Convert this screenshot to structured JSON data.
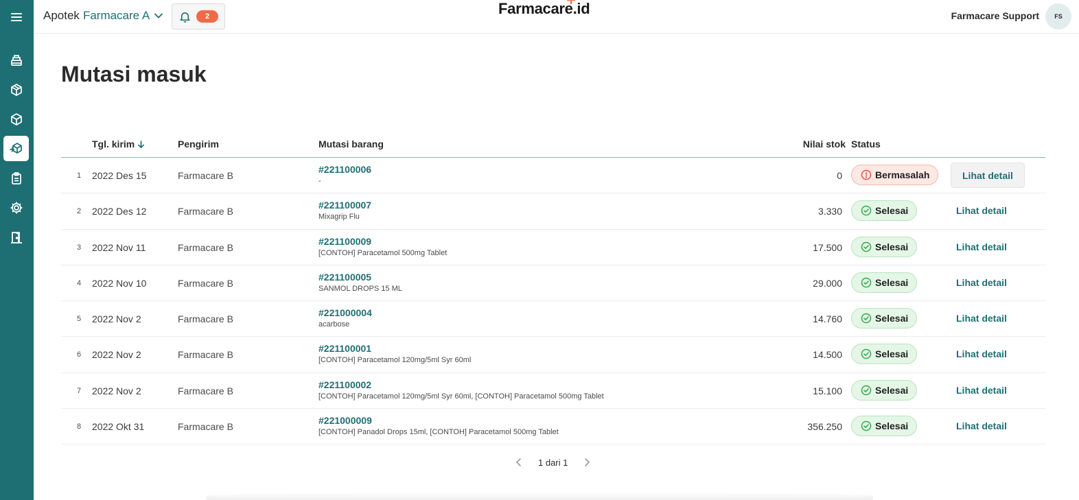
{
  "header": {
    "store_prefix": "Apotek",
    "store_name": "Farmacare A",
    "notification_count": "2",
    "logo_text_main": "Farmacare",
    "logo_text_suffix": ".id",
    "user_name": "Farmacare Support",
    "avatar_initials": "FS"
  },
  "sidebar": {
    "items": [
      {
        "icon": "menu-icon"
      },
      {
        "icon": "cash-register-icon"
      },
      {
        "icon": "box-icon"
      },
      {
        "icon": "package-icon"
      },
      {
        "icon": "box-transfer-icon",
        "active": true
      },
      {
        "icon": "clipboard-icon"
      },
      {
        "icon": "gear-icon"
      },
      {
        "icon": "exit-door-icon"
      }
    ]
  },
  "page": {
    "title": "Mutasi masuk"
  },
  "table": {
    "headers": {
      "date": "Tgl. kirim",
      "sender": "Pengirim",
      "mutation": "Mutasi barang",
      "value": "Nilai stok",
      "status": "Status"
    },
    "rows": [
      {
        "no": "1",
        "date": "2022 Des 15",
        "sender": "Farmacare B",
        "code": "#221100006",
        "items": "-",
        "value": "0",
        "status": "Bermasalah",
        "status_type": "bad",
        "action": "Lihat detail"
      },
      {
        "no": "2",
        "date": "2022 Des 12",
        "sender": "Farmacare B",
        "code": "#221100007",
        "items": "Mixagrip Flu",
        "value": "3.330",
        "status": "Selesai",
        "status_type": "ok",
        "action": "Lihat detail"
      },
      {
        "no": "3",
        "date": "2022 Nov 11",
        "sender": "Farmacare B",
        "code": "#221100009",
        "items": "[CONTOH] Paracetamol 500mg Tablet",
        "value": "17.500",
        "status": "Selesai",
        "status_type": "ok",
        "action": "Lihat detail"
      },
      {
        "no": "4",
        "date": "2022 Nov 10",
        "sender": "Farmacare B",
        "code": "#221100005",
        "items": "SANMOL DROPS 15 ML",
        "value": "29.000",
        "status": "Selesai",
        "status_type": "ok",
        "action": "Lihat detail"
      },
      {
        "no": "5",
        "date": "2022 Nov 2",
        "sender": "Farmacare B",
        "code": "#221000004",
        "items": "acarbose",
        "value": "14.760",
        "status": "Selesai",
        "status_type": "ok",
        "action": "Lihat detail"
      },
      {
        "no": "6",
        "date": "2022 Nov 2",
        "sender": "Farmacare B",
        "code": "#221100001",
        "items": "[CONTOH] Paracetamol 120mg/5ml Syr 60ml",
        "value": "14.500",
        "status": "Selesai",
        "status_type": "ok",
        "action": "Lihat detail"
      },
      {
        "no": "7",
        "date": "2022 Nov 2",
        "sender": "Farmacare B",
        "code": "#221100002",
        "items": "[CONTOH] Paracetamol 120mg/5ml Syr 60ml, [CONTOH] Paracetamol 500mg Tablet",
        "value": "15.100",
        "status": "Selesai",
        "status_type": "ok",
        "action": "Lihat detail"
      },
      {
        "no": "8",
        "date": "2022 Okt 31",
        "sender": "Farmacare B",
        "code": "#221000009",
        "items": "[CONTOH] Panadol Drops 15ml, [CONTOH] Paracetamol 500mg Tablet",
        "value": "356.250",
        "status": "Selesai",
        "status_type": "ok",
        "action": "Lihat detail"
      }
    ]
  },
  "pagination": {
    "label": "1 dari 1"
  },
  "colors": {
    "brand": "#1e6f73",
    "accent_orange": "#ee6a48",
    "success_green": "#3aa64a",
    "danger_red": "#e0533f"
  }
}
